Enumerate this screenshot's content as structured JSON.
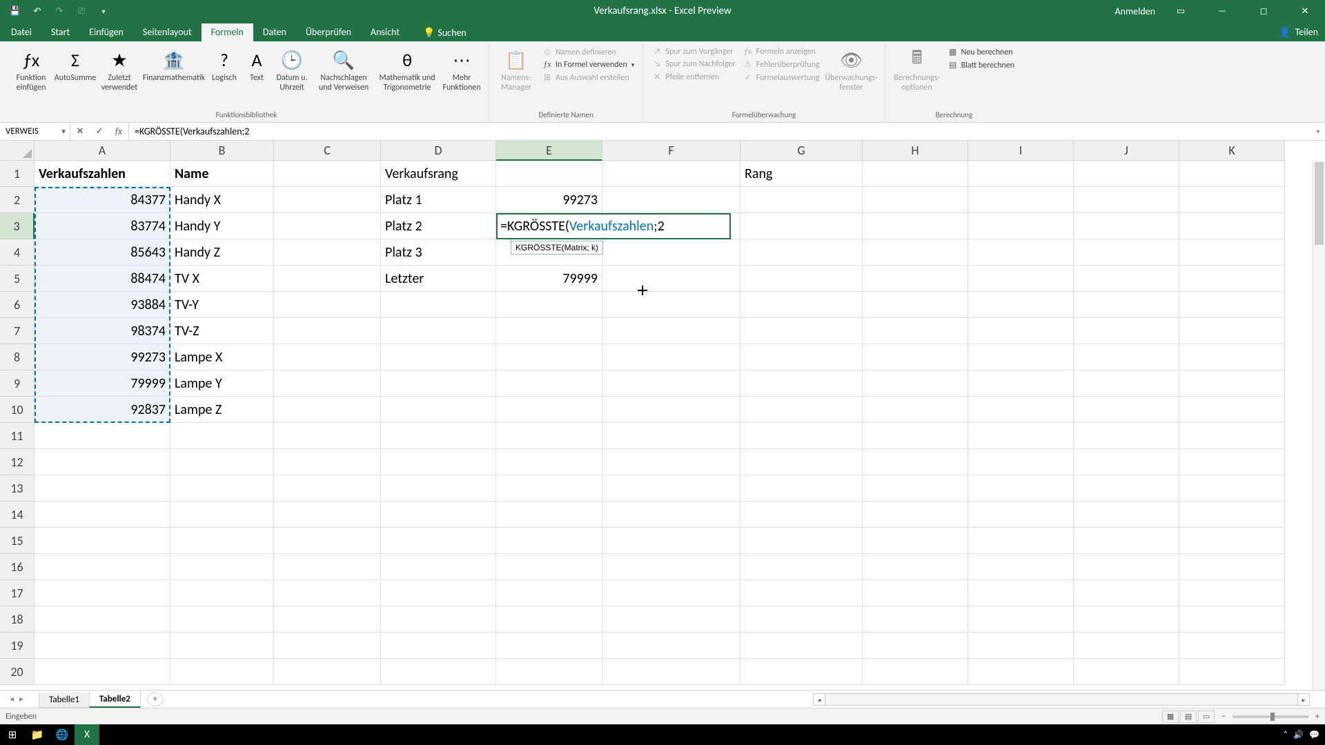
{
  "title": "Verkaufsrang.xlsx - Excel Preview",
  "qat": {
    "save": "💾",
    "undo": "↶",
    "redo": "↷",
    "touch": "👆"
  },
  "signin": "Anmelden",
  "menu": {
    "tabs": [
      "Datei",
      "Start",
      "Einfügen",
      "Seitenlayout",
      "Formeln",
      "Daten",
      "Überprüfen",
      "Ansicht"
    ],
    "active": "Formeln",
    "search": "Suchen",
    "share": "Teilen"
  },
  "ribbon": {
    "fx": {
      "insert": "Funktion\neinfügen",
      "autosum": "AutoSumme",
      "recent": "Zuletzt\nverwendet",
      "financial": "Finanzmathematik",
      "logical": "Logisch",
      "text": "Text",
      "datetime": "Datum u.\nUhrzeit",
      "lookup": "Nachschlagen\nund Verweisen",
      "math": "Mathematik und\nTrigonometrie",
      "more": "Mehr\nFunktionen",
      "group": "Funktionsbibliothek"
    },
    "names": {
      "manager": "Namens-\nManager",
      "define": "Namen definieren",
      "use": "In Formel verwenden",
      "create": "Aus Auswahl erstellen",
      "group": "Definierte Namen"
    },
    "audit": {
      "trace_prec": "Spur zum Vorgänger",
      "trace_dep": "Spur zum Nachfolger",
      "remove": "Pfeile entfernen",
      "show": "Formeln anzeigen",
      "error": "Fehlerüberprüfung",
      "eval": "Formelauswertung",
      "watch": "Überwachungs-\nfenster",
      "group": "Formelüberwachung"
    },
    "calc": {
      "options": "Berechnungs-\noptionen",
      "now": "Neu berechnen",
      "sheet": "Blatt berechnen",
      "group": "Berechnung"
    }
  },
  "namebox": "VERWEIS",
  "formula": "=KGRÖSSTE(Verkaufszahlen;2",
  "columns": [
    "A",
    "B",
    "C",
    "D",
    "E",
    "F",
    "G",
    "H",
    "I",
    "J",
    "K"
  ],
  "rows": [
    "1",
    "2",
    "3",
    "4",
    "5",
    "6",
    "7",
    "8",
    "9",
    "10",
    "11",
    "12",
    "13",
    "14",
    "15",
    "16",
    "17",
    "18",
    "19",
    "20"
  ],
  "cells": {
    "A1": "Verkaufszahlen",
    "B1": "Name",
    "D1": "Verkaufsrang",
    "G1": "Rang",
    "A2": "84377",
    "B2": "Handy X",
    "D2": "Platz 1",
    "E2": "99273",
    "A3": "83774",
    "B3": "Handy Y",
    "D3": "Platz 2",
    "A4": "85643",
    "B4": "Handy Z",
    "D4": "Platz 3",
    "A5": "88474",
    "B5": "TV X",
    "D5": "Letzter",
    "E5": "79999",
    "A6": "93884",
    "B6": "TV-Y",
    "A7": "98374",
    "B7": "TV-Z",
    "A8": "99273",
    "B8": "Lampe X",
    "A9": "79999",
    "B9": "Lampe Y",
    "A10": "92837",
    "B10": "Lampe Z"
  },
  "edit": {
    "prefix": "=KGRÖSSTE(",
    "ref": "Verkaufszahlen",
    "suffix": ";2"
  },
  "tooltip": "KGRÖSSTE(Matrix; k)",
  "sheets": {
    "tabs": [
      "Tabelle1",
      "Tabelle2"
    ],
    "active": "Tabelle2"
  },
  "status": "Eingeben",
  "zoom": "",
  "taskbar_time": ""
}
